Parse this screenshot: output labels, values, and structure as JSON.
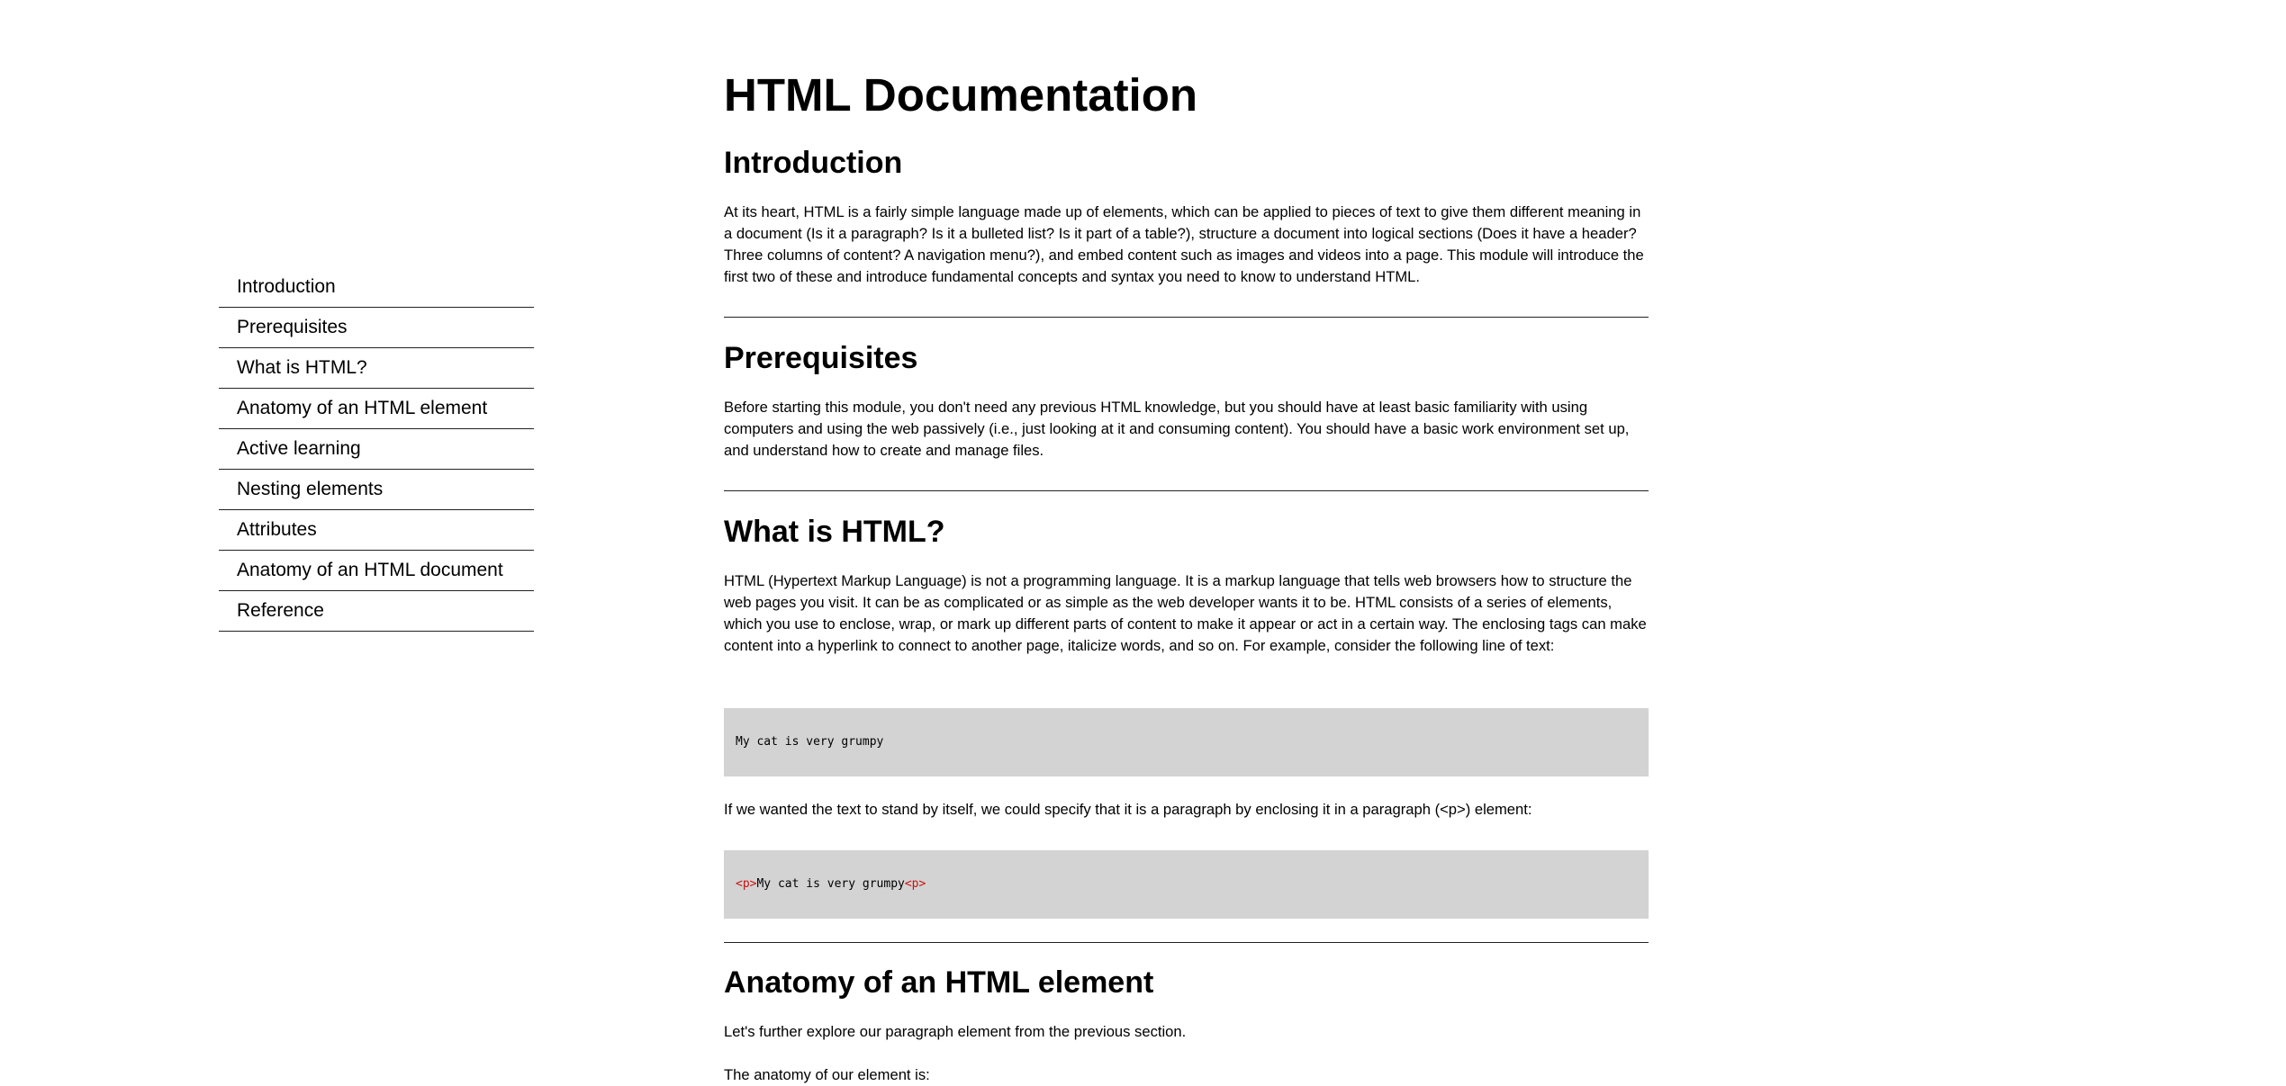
{
  "nav": {
    "items": [
      {
        "label": "Introduction"
      },
      {
        "label": "Prerequisites"
      },
      {
        "label": "What is HTML?"
      },
      {
        "label": "Anatomy of an HTML element"
      },
      {
        "label": "Active learning"
      },
      {
        "label": "Nesting elements"
      },
      {
        "label": "Attributes"
      },
      {
        "label": "Anatomy of an HTML document"
      },
      {
        "label": "Reference"
      }
    ]
  },
  "main": {
    "title": "HTML Documentation",
    "introduction": {
      "heading": "Introduction",
      "text": "At its heart, HTML is a fairly simple language made up of elements, which can be applied to pieces of text to give them different meaning in a document (Is it a paragraph? Is it a bulleted list? Is it part of a table?), structure a document into logical sections (Does it have a header? Three columns of content? A navigation menu?), and embed content such as images and videos into a page. This module will introduce the first two of these and introduce fundamental concepts and syntax you need to know to understand HTML."
    },
    "prerequisites": {
      "heading": "Prerequisites",
      "text": "Before starting this module, you don't need any previous HTML knowledge, but you should have at least basic familiarity with using computers and using the web passively (i.e., just looking at it and consuming content). You should have a basic work environment set up, and understand how to create and manage files."
    },
    "what_is_html": {
      "heading": "What is HTML?",
      "text": "HTML (Hypertext Markup Language) is not a programming language. It is a markup language that tells web browsers how to structure the web pages you visit. It can be as complicated or as simple as the web developer wants it to be. HTML consists of a series of elements, which you use to enclose, wrap, or mark up different parts of content to make it appear or act in a certain way. The enclosing tags can make content into a hyperlink to connect to another page, italicize words, and so on. For example, consider the following line of text:",
      "code1": "My cat is very grumpy",
      "text2": "If we wanted the text to stand by itself, we could specify that it is a paragraph by enclosing it in a paragraph (<p>) element:",
      "code2": {
        "open_tag": "<p>",
        "content": "My cat is very grumpy",
        "close_tag": "<p>"
      }
    },
    "anatomy": {
      "heading": "Anatomy of an HTML element",
      "text": "Let's further explore our paragraph element from the previous section.",
      "text2": "The anatomy of our element is:"
    }
  }
}
